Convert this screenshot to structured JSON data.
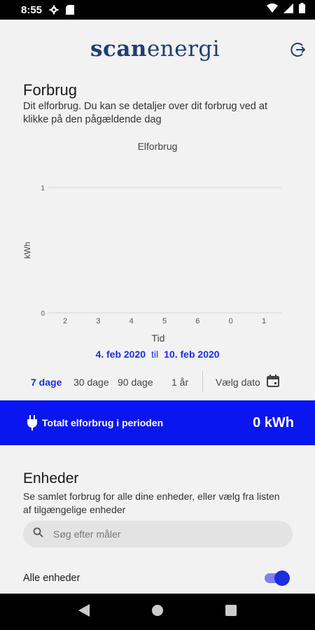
{
  "status_bar": {
    "time": "8:55"
  },
  "header": {
    "logo_bold": "scan",
    "logo_mid": "en",
    "logo_light": "ergi"
  },
  "page": {
    "title": "Forbrug",
    "description": "Dit elforbrug. Du kan se detaljer over dit forbrug ved at klikke på den pågældende dag"
  },
  "chart_data": {
    "type": "bar",
    "title": "Elforbrug",
    "xlabel": "Tid",
    "ylabel": "kWh",
    "categories": [
      "2",
      "3",
      "4",
      "5",
      "6",
      "0",
      "1"
    ],
    "values": [
      0,
      0,
      0,
      0,
      0,
      0,
      0
    ],
    "yticks": [
      "1",
      "0"
    ],
    "ylim": [
      0,
      1
    ],
    "grid": true
  },
  "period": {
    "from": "4. feb 2020",
    "til": "til",
    "to": "10. feb 2020"
  },
  "range_options": {
    "days7": "7 dage",
    "days30": "30 dage",
    "days90": "90 dage",
    "year1": "1 år",
    "pick_date": "Vælg dato"
  },
  "total": {
    "label": "Totalt elforbrug i perioden",
    "value": "0 kWh"
  },
  "devices": {
    "title": "Enheder",
    "description": "Se samlet forbrug for alle dine enheder, eller vælg fra listen af tilgængelige enheder",
    "search_placeholder": "Søg efter måler",
    "all_label": "Alle enheder",
    "all_enabled": true
  },
  "colors": {
    "accent": "#0a16f0",
    "link": "#1b2ee0",
    "logo": "#1f3f6f"
  }
}
